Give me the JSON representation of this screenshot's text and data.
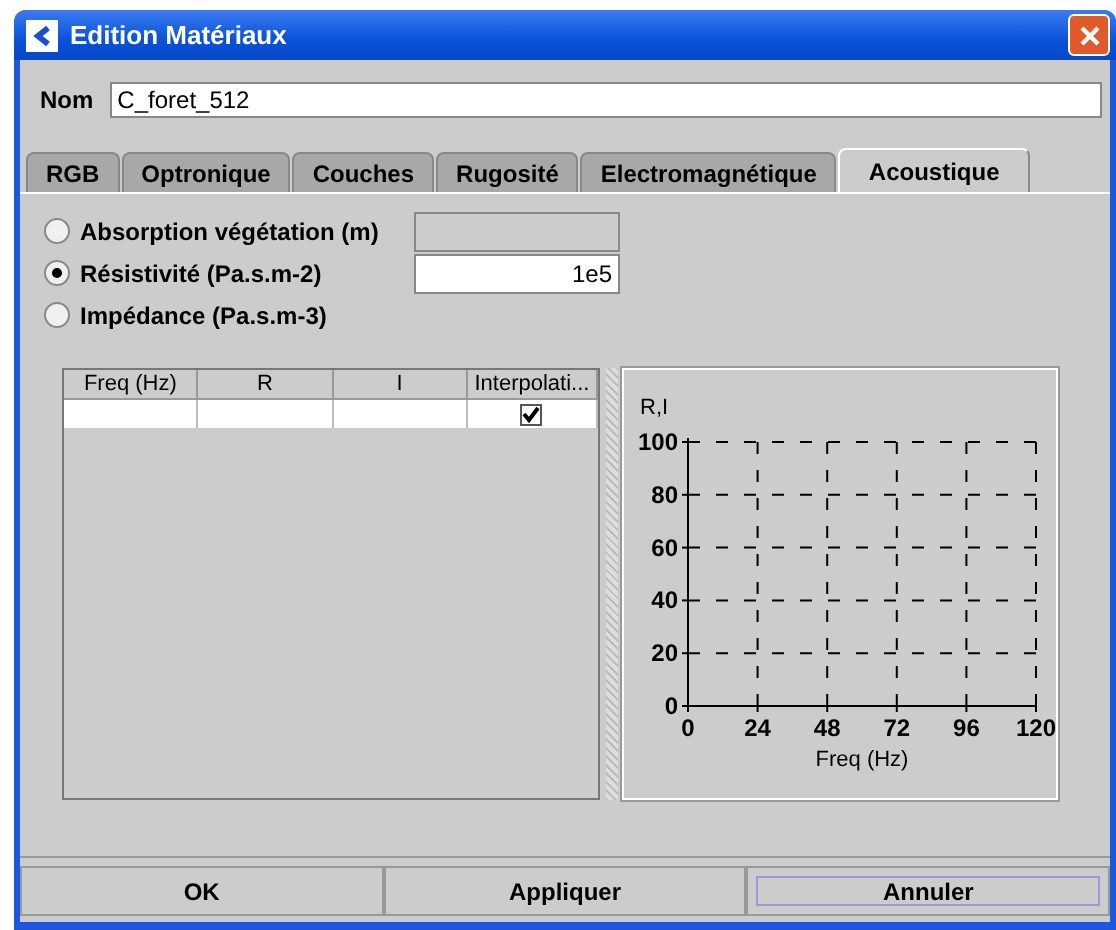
{
  "window": {
    "title": "Edition Matériaux"
  },
  "name_field": {
    "label": "Nom",
    "value": "C_foret_512"
  },
  "tabs": [
    {
      "label": "RGB",
      "selected": false
    },
    {
      "label": "Optronique",
      "selected": false
    },
    {
      "label": "Couches",
      "selected": false
    },
    {
      "label": "Rugosité",
      "selected": false
    },
    {
      "label": "Electromagnétique",
      "selected": false
    },
    {
      "label": "Acoustique",
      "selected": true
    }
  ],
  "options": [
    {
      "label": "Absorption végétation (m)",
      "selected": false,
      "kind": "field",
      "disabled": true
    },
    {
      "label": "Résistivité (Pa.s.m-2)",
      "selected": true,
      "kind": "field",
      "disabled": false,
      "value": "1e5"
    },
    {
      "label": "Impédance (Pa.s.m-3)",
      "selected": false,
      "kind": "plain"
    }
  ],
  "table": {
    "columns": [
      "Freq (Hz)",
      "R",
      "I",
      "Interpolati..."
    ],
    "rows": [
      {
        "interpolation": true
      }
    ]
  },
  "chart": {
    "chart_data": {
      "type": "line",
      "xlabel": "Freq (Hz)",
      "ylabel": "R,I",
      "xlim": [
        0,
        120
      ],
      "ylim": [
        0,
        100
      ],
      "xticks": [
        0,
        24,
        48,
        72,
        96,
        120
      ],
      "yticks": [
        0,
        20,
        40,
        60,
        80,
        100
      ],
      "grid": true
    }
  },
  "buttons": [
    {
      "label": "OK",
      "focused": false
    },
    {
      "label": "Appliquer",
      "focused": false
    },
    {
      "label": "Annuler",
      "focused": true
    }
  ]
}
